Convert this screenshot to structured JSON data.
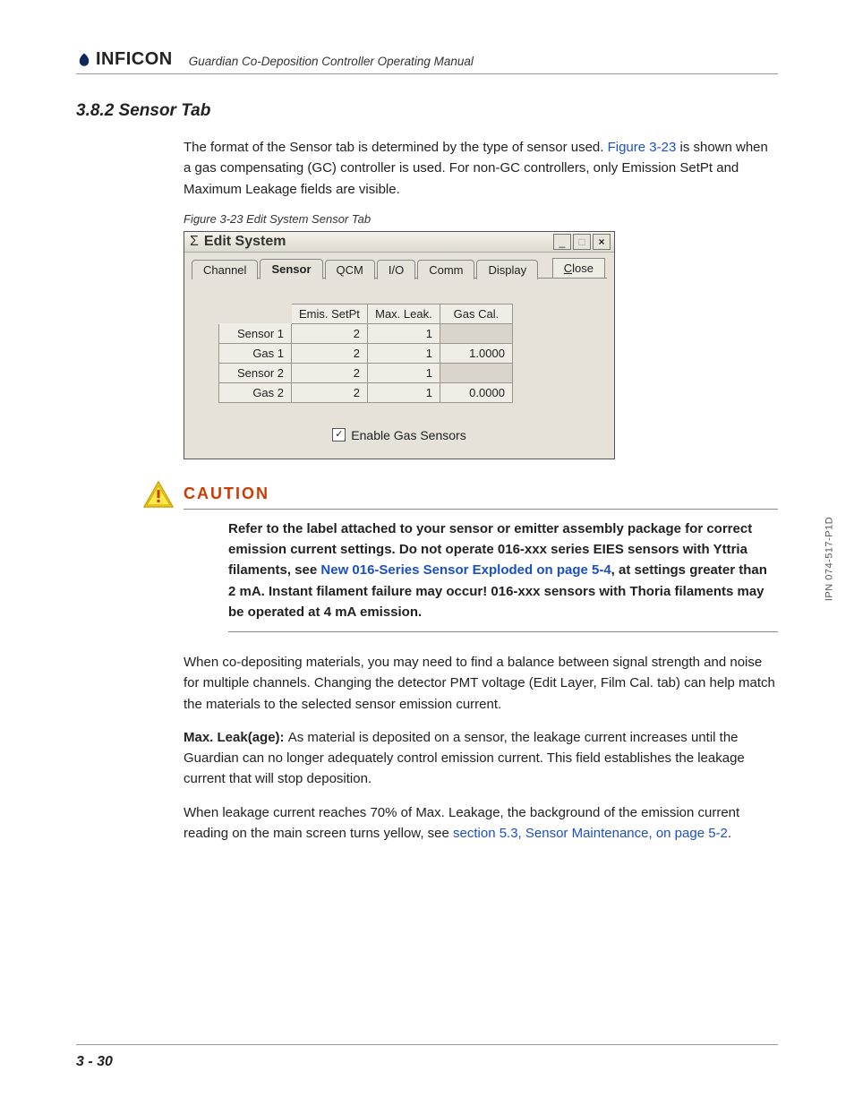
{
  "header": {
    "brand": "INFICON",
    "doc_title": "Guardian Co-Deposition Controller Operating Manual"
  },
  "section": {
    "number_title": "3.8.2  Sensor Tab",
    "para1_a": "The format of the Sensor tab is determined by the type of sensor used. ",
    "para1_link": "Figure 3-23",
    "para1_b": " is shown when a gas compensating (GC) controller is used. For non-GC controllers, only Emission SetPt and Maximum Leakage fields are visible."
  },
  "figure": {
    "caption": "Figure 3-23  Edit System Sensor Tab"
  },
  "dialog": {
    "title": "Edit System",
    "tabs": [
      "Channel",
      "Sensor",
      "QCM",
      "I/O",
      "Comm",
      "Display"
    ],
    "active_tab_index": 1,
    "close_label": "Close",
    "table": {
      "headers": [
        "Emis. SetPt",
        "Max. Leak.",
        "Gas Cal."
      ],
      "rows": [
        {
          "label": "Sensor 1",
          "emis": "2",
          "leak": "1",
          "gas": ""
        },
        {
          "label": "Gas 1",
          "emis": "2",
          "leak": "1",
          "gas": "1.0000"
        },
        {
          "label": "Sensor 2",
          "emis": "2",
          "leak": "1",
          "gas": ""
        },
        {
          "label": "Gas 2",
          "emis": "2",
          "leak": "1",
          "gas": "0.0000"
        }
      ]
    },
    "enable_label": "Enable Gas Sensors",
    "enable_checked": true
  },
  "caution": {
    "title": "CAUTION",
    "body_a": "Refer to the label attached to your sensor or emitter assembly package for correct emission current settings. Do not operate 016-xxx series EIES sensors with Yttria filaments, see ",
    "body_link": "New 016-Series Sensor Exploded on page 5-4",
    "body_b": ", at settings greater than 2 mA. Instant filament failure may occur! 016-xxx sensors with Thoria filaments may be operated at 4 mA emission."
  },
  "post": {
    "para2": "When co-depositing materials, you may need to find a balance between signal strength and noise for multiple channels. Changing the detector PMT voltage (Edit Layer, Film Cal. tab) can help match the materials to the selected sensor emission current.",
    "para3_lead": "Max. Leak(age): ",
    "para3_rest": "As material is deposited on a sensor, the leakage current increases until the Guardian can no longer adequately control emission current. This field establishes the leakage current that will stop deposition.",
    "para4_a": "When leakage current reaches 70% of Max. Leakage, the background of the emission current reading on the main screen turns yellow, see ",
    "para4_link": "section 5.3, Sensor Maintenance, on page 5-2",
    "para4_b": "."
  },
  "footer": {
    "page": "3 - 30",
    "ipn": "IPN 074-517-P1D"
  }
}
